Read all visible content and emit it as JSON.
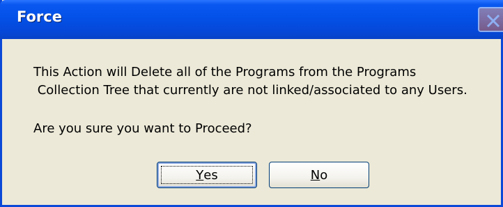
{
  "window": {
    "title": "Force",
    "close_icon": "close-icon"
  },
  "message": {
    "line1": "This Action will Delete all of the Programs from the Programs",
    "line2": " Collection Tree that currently are not linked/associated to any Users.",
    "question": "Are you sure you want to Proceed?"
  },
  "buttons": {
    "yes": {
      "mnemonic": "Y",
      "rest": "es"
    },
    "no": {
      "mnemonic": "N",
      "rest": "o"
    }
  },
  "colors": {
    "titlebar": "#0451e8",
    "dialog_bg": "#ece9d8",
    "border": "#0b49d8"
  }
}
